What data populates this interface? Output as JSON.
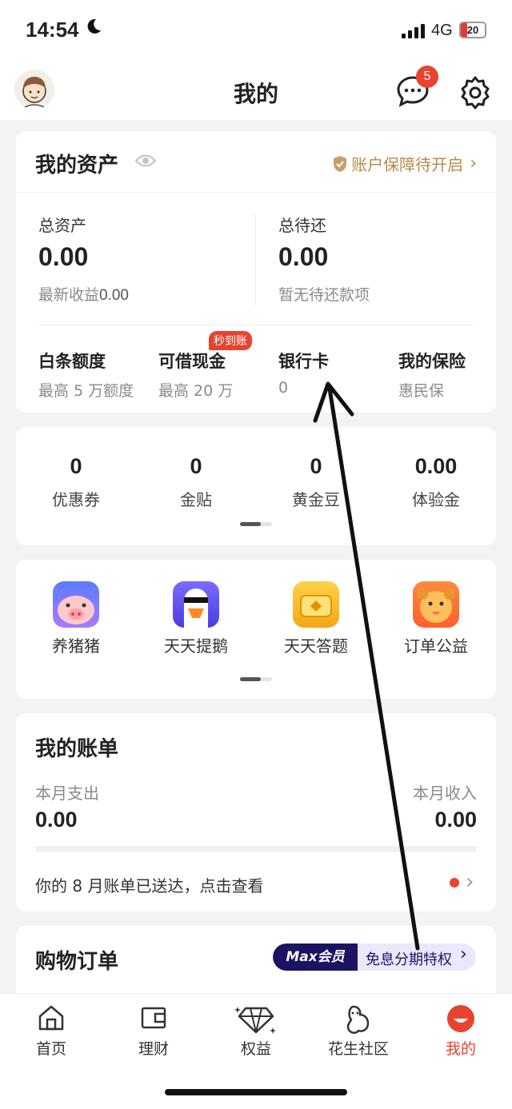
{
  "status_bar": {
    "time": "14:54",
    "network": "4G",
    "battery": "20"
  },
  "header": {
    "title": "我的",
    "message_badge": "5"
  },
  "assets": {
    "title": "我的资产",
    "protection_text": "账户保障待开启",
    "total_assets_label": "总资产",
    "total_assets_value": "0.00",
    "latest_income_label": "最新收益",
    "latest_income_value": "0.00",
    "pending_repay_label": "总待还",
    "pending_repay_value": "0.00",
    "pending_repay_note": "暂无待还款项",
    "items": [
      {
        "title": "白条额度",
        "sub": "最高 5 万额度"
      },
      {
        "title": "可借现金",
        "sub": "最高 20 万",
        "tag": "秒到账"
      },
      {
        "title": "银行卡",
        "sub": "0"
      },
      {
        "title": "我的保险",
        "sub": "惠民保"
      }
    ]
  },
  "benefits": [
    {
      "value": "0",
      "label": "优惠券"
    },
    {
      "value": "0",
      "label": "金贴"
    },
    {
      "value": "0",
      "label": "黄金豆"
    },
    {
      "value": "0.00",
      "label": "体验金"
    }
  ],
  "games": [
    {
      "label": "养猪猪",
      "icon": "pig-icon"
    },
    {
      "label": "天天提鹅",
      "icon": "goose-icon"
    },
    {
      "label": "天天答题",
      "icon": "coin-icon"
    },
    {
      "label": "订单公益",
      "icon": "dog-icon"
    }
  ],
  "bill": {
    "title": "我的账单",
    "expense_label": "本月支出",
    "expense_value": "0.00",
    "income_label": "本月收入",
    "income_value": "0.00",
    "notice": "你的 8 月账单已送达，点击查看"
  },
  "orders": {
    "title": "购物订单",
    "max_badge": "Max会员",
    "promo": "免息分期特权"
  },
  "tabbar": [
    {
      "label": "首页"
    },
    {
      "label": "理财"
    },
    {
      "label": "权益"
    },
    {
      "label": "花生社区"
    },
    {
      "label": "我的"
    }
  ],
  "colors": {
    "accent": "#e8432f",
    "gold": "#b8894a",
    "max_badge": "#1a1462"
  }
}
